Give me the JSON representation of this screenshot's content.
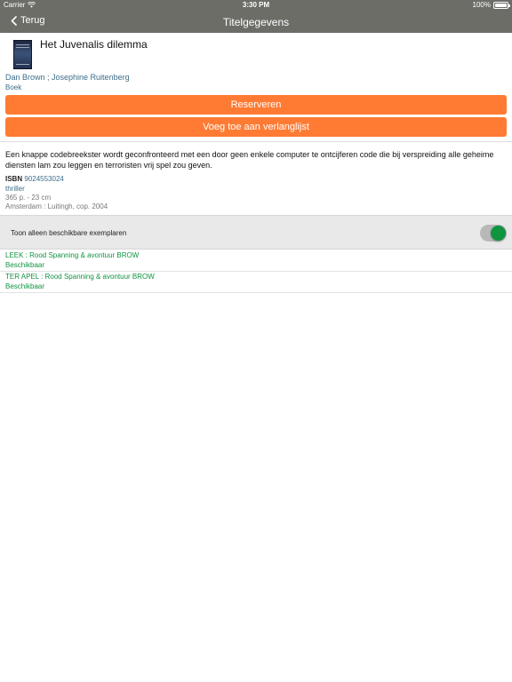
{
  "status_bar": {
    "carrier": "Carrier",
    "time": "3:30 PM",
    "battery": "100%"
  },
  "nav": {
    "back_label": "Terug",
    "title": "Titelgegevens"
  },
  "book": {
    "title": "Het Juvenalis dilemma",
    "authors": "Dan Brown ; Josephine Ruitenberg",
    "type": "Boek"
  },
  "actions": {
    "reserve_label": "Reserveren",
    "wishlist_label": "Voeg toe aan verlanglijst"
  },
  "details": {
    "description": "Een knappe codebreekster wordt geconfronteerd met een door geen enkele computer te ontcijferen code die bij verspreiding alle geheime diensten lam zou leggen en terroristen vrij spel zou geven.",
    "isbn_label": "ISBN",
    "isbn_value": "9024553024",
    "genre": "thriller",
    "extent": "365 p. - 23 cm",
    "publication": "Amsterdam : Luitingh, cop. 2004"
  },
  "filter": {
    "label": "Toon alleen beschikbare exemplaren",
    "enabled": true
  },
  "copies": [
    {
      "location": "LEEK : Rood Spanning & avontuur BROW",
      "status": "Beschikbaar"
    },
    {
      "location": "TER APEL : Rood Spanning & avontuur BROW",
      "status": "Beschikbaar"
    }
  ],
  "colors": {
    "bar": "#6d6d68",
    "accent": "#ff7b33",
    "link": "#3b6e8a",
    "available": "#0f9440"
  }
}
